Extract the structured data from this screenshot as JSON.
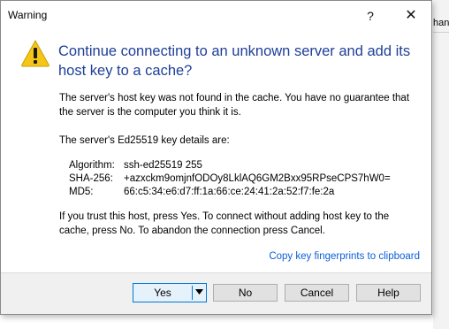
{
  "background": {
    "fragment_text": "hang"
  },
  "dialog": {
    "title": "Warning",
    "help_glyph": "?",
    "close_glyph": "✕",
    "icon": "warning-triangle-icon",
    "heading": "Continue connecting to an unknown server and add its host key to a cache?",
    "para1": "The server's host key was not found in the cache. You have no guarantee that the server is the computer you think it is.",
    "para2": "The server's Ed25519 key details are:",
    "details": [
      {
        "key": "Algorithm:",
        "value": "ssh-ed25519 255"
      },
      {
        "key": "SHA-256:",
        "value": "+azxckm9omjnfODOy8LklAQ6GM2Bxx95RPseCPS7hW0="
      },
      {
        "key": "MD5:",
        "value": "66:c5:34:e6:d7:ff:1a:66:ce:24:41:2a:52:f7:fe:2a"
      }
    ],
    "para3": "If you trust this host, press Yes. To connect without adding host key to the cache, press No. To abandon the connection press Cancel.",
    "copy_link": "Copy key fingerprints to clipboard",
    "buttons": {
      "yes": "Yes",
      "no": "No",
      "cancel": "Cancel",
      "help": "Help"
    }
  },
  "colors": {
    "heading": "#1e3f99",
    "link": "#0b5fd8",
    "focus_border": "#0078d7",
    "warning_yellow": "#f5c518"
  }
}
